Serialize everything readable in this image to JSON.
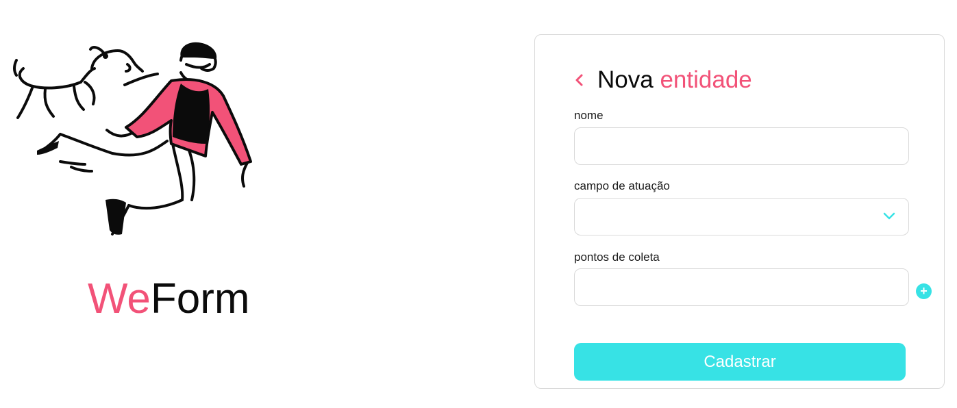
{
  "brand": {
    "part1": "We",
    "part2": "Form"
  },
  "form": {
    "title_part1": "Nova",
    "title_part2": "entidade",
    "fields": [
      {
        "label": "nome",
        "value": ""
      },
      {
        "label": "campo de atuação",
        "value": ""
      },
      {
        "label": "pontos de coleta",
        "value": ""
      }
    ],
    "submit_label": "Cadastrar"
  },
  "colors": {
    "accent_pink": "#F25278",
    "accent_cyan": "#37E2E5",
    "border": "#d9d9d9"
  },
  "icons": {
    "back": "chevron-left-icon",
    "dropdown": "chevron-down-icon",
    "add": "plus-circle-icon"
  }
}
